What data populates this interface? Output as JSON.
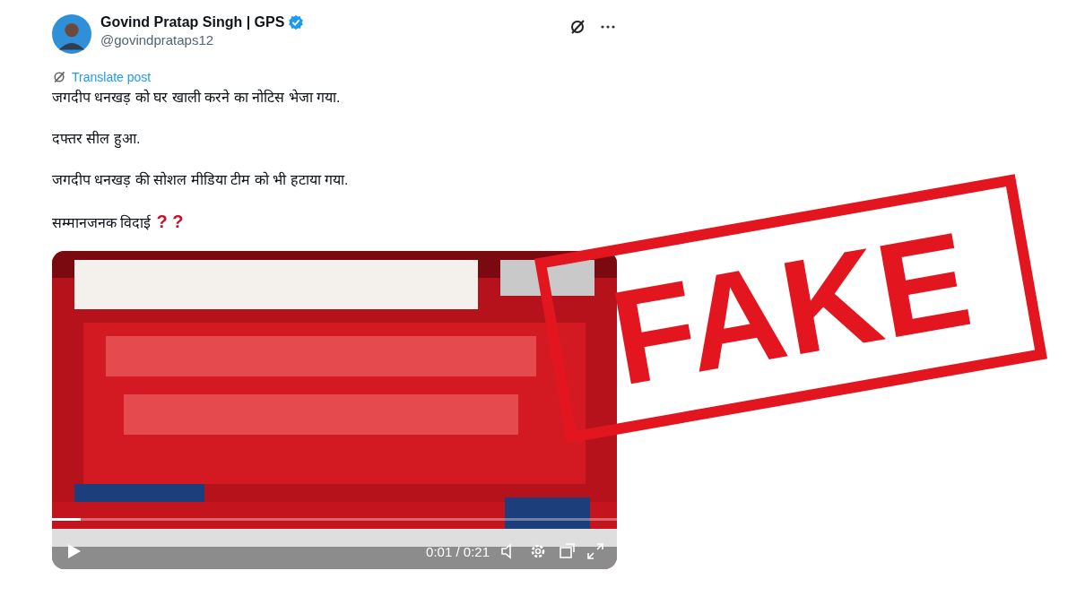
{
  "author": {
    "name": "Govind Pratap Singh | GPS",
    "verified": true,
    "handle": "@govindprataps12"
  },
  "translate": "Translate post",
  "paragraphs": [
    "जगदीप धनखड़ को घर खाली करने का नोटिस भेजा गया.",
    "दफ्तर सील हुआ.",
    "जगदीप धनखड़ की सोशल मीडिया टीम को भी हटाया गया.",
    "सम्मानजनक विदाई"
  ],
  "last_marks": "? ?",
  "video": {
    "kind": "picture",
    "progress": {
      "level": 0.05
    },
    "time": "0:01 / 0:21"
  },
  "stamp": "FAKE"
}
